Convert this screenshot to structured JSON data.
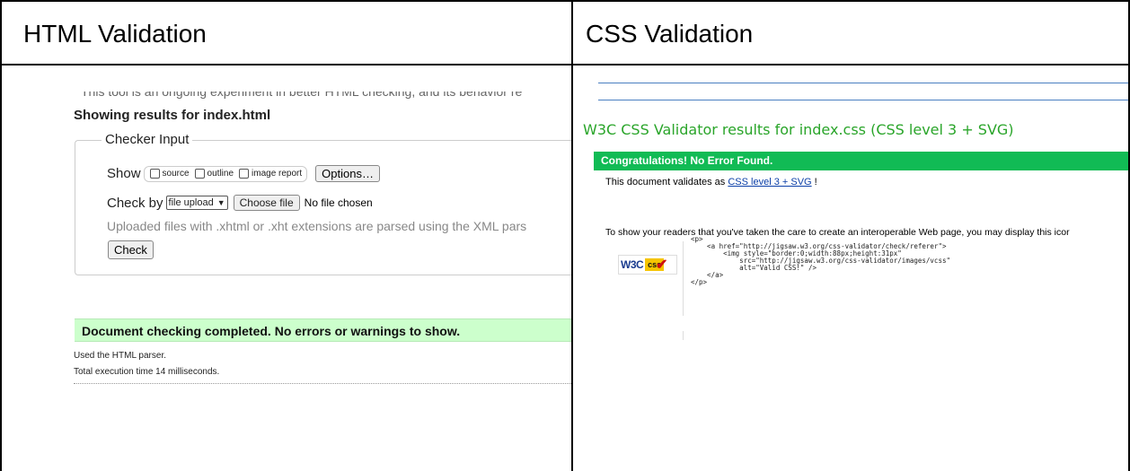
{
  "headers": {
    "left": "HTML Validation",
    "right": "CSS Validation"
  },
  "html_validator": {
    "cut_off_text": "This tool is an ongoing experiment in better HTML checking, and its behavior re",
    "results_title": "Showing results for index.html",
    "legend": "Checker Input",
    "show_label": "Show",
    "show_options": [
      "source",
      "outline",
      "image report"
    ],
    "options_button": "Options…",
    "check_by_label": "Check by",
    "check_by_value": "file upload",
    "choose_file_button": "Choose file",
    "file_status": "No file chosen",
    "hint": "Uploaded files with .xhtml or .xht extensions are parsed using the XML pars",
    "check_button": "Check",
    "success_message": "Document checking completed. No errors or warnings to show.",
    "parser_info": "Used the HTML parser.",
    "execution_time": "Total execution time 14 milliseconds."
  },
  "css_validator": {
    "title": "W3C CSS Validator results for index.css (CSS level 3 + SVG)",
    "success_banner": "Congratulations! No Error Found.",
    "validates_prefix": "This document validates as ",
    "validates_link": "CSS level 3 + SVG",
    "validates_suffix": " !",
    "readers_text": "To show your readers that you've taken the care to create an interoperable Web page, you may display this icor",
    "badge_w3c": "W3C",
    "badge_css": "css",
    "code_snippet": "<p>\n    <a href=\"http://jigsaw.w3.org/css-validator/check/referer\">\n        <img style=\"border:0;width:88px;height:31px\"\n            src=\"http://jigsaw.w3.org/css-validator/images/vcss\"\n            alt=\"Valid CSS!\" />\n    </a>\n</p>"
  },
  "colors": {
    "html_success_bg": "#ccffcc",
    "css_title": "#2aa52a",
    "css_banner": "#11bb55",
    "link": "#0b3fa8"
  }
}
